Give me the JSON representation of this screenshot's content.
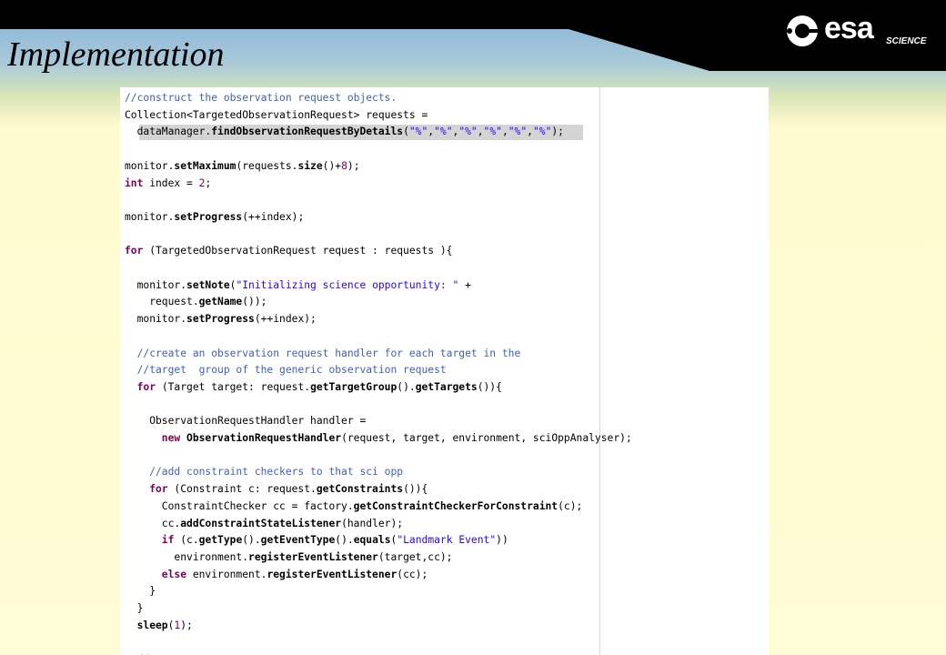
{
  "slide": {
    "title": "Implementation",
    "logo": {
      "word": "esa",
      "subtitle": "SCIENCE"
    }
  },
  "code": {
    "lines": [
      [
        [
          "comment",
          "//construct the observation request objects."
        ]
      ],
      [
        [
          "plain",
          "Collection<TargetedObservationRequest> requests ="
        ]
      ],
      [
        [
          "plain",
          "  dataManager."
        ],
        [
          "method",
          "findObservationRequestByDetails"
        ],
        [
          "plain",
          "("
        ],
        [
          "str",
          "\"%\""
        ],
        [
          "plain",
          ","
        ],
        [
          "str",
          "\"%\""
        ],
        [
          "plain",
          ","
        ],
        [
          "str",
          "\"%\""
        ],
        [
          "plain",
          ","
        ],
        [
          "str",
          "\"%\""
        ],
        [
          "plain",
          ","
        ],
        [
          "str",
          "\"%\""
        ],
        [
          "plain",
          ","
        ],
        [
          "str",
          "\"%\""
        ],
        [
          "plain",
          ");"
        ]
      ],
      [],
      [
        [
          "plain",
          "monitor."
        ],
        [
          "method",
          "setMaximum"
        ],
        [
          "plain",
          "(requests."
        ],
        [
          "method",
          "size"
        ],
        [
          "plain",
          "()+"
        ],
        [
          "num",
          "8"
        ],
        [
          "plain",
          ");"
        ]
      ],
      [
        [
          "kw",
          "int"
        ],
        [
          "plain",
          " index = "
        ],
        [
          "num",
          "2"
        ],
        [
          "plain",
          ";"
        ]
      ],
      [],
      [
        [
          "plain",
          "monitor."
        ],
        [
          "method",
          "setProgress"
        ],
        [
          "plain",
          "(++index);"
        ]
      ],
      [],
      [
        [
          "kw",
          "for"
        ],
        [
          "plain",
          " (TargetedObservationRequest request : requests ){"
        ]
      ],
      [],
      [
        [
          "plain",
          "  monitor."
        ],
        [
          "method",
          "setNote"
        ],
        [
          "plain",
          "("
        ],
        [
          "str",
          "\"Initializing science opportunity: \""
        ],
        [
          "plain",
          " +"
        ]
      ],
      [
        [
          "plain",
          "    request."
        ],
        [
          "method",
          "getName"
        ],
        [
          "plain",
          "());"
        ]
      ],
      [
        [
          "plain",
          "  monitor."
        ],
        [
          "method",
          "setProgress"
        ],
        [
          "plain",
          "(++index);"
        ]
      ],
      [],
      [
        [
          "comment",
          "  //create an observation request handler for each target in the"
        ]
      ],
      [
        [
          "comment",
          "  //target  group of the generic observation request"
        ]
      ],
      [
        [
          "kw",
          "  for"
        ],
        [
          "plain",
          " (Target target: request."
        ],
        [
          "method",
          "getTargetGroup"
        ],
        [
          "plain",
          "()."
        ],
        [
          "method",
          "getTargets"
        ],
        [
          "plain",
          "()){"
        ]
      ],
      [],
      [
        [
          "plain",
          "    ObservationRequestHandler handler ="
        ]
      ],
      [
        [
          "kw",
          "      new"
        ],
        [
          "plain",
          " "
        ],
        [
          "method",
          "ObservationRequestHandler"
        ],
        [
          "plain",
          "(request, target, environment, sciOppAnalyser);"
        ]
      ],
      [],
      [
        [
          "comment",
          "    //add constraint checkers to that sci opp"
        ]
      ],
      [
        [
          "kw",
          "    for"
        ],
        [
          "plain",
          " (Constraint c: request."
        ],
        [
          "method",
          "getConstraints"
        ],
        [
          "plain",
          "()){"
        ]
      ],
      [
        [
          "plain",
          "      ConstraintChecker cc = factory."
        ],
        [
          "method",
          "getConstraintCheckerForConstraint"
        ],
        [
          "plain",
          "(c);"
        ]
      ],
      [
        [
          "plain",
          "      cc."
        ],
        [
          "method",
          "addConstraintStateListener"
        ],
        [
          "plain",
          "(handler);"
        ]
      ],
      [
        [
          "kw",
          "      if"
        ],
        [
          "plain",
          " (c."
        ],
        [
          "method",
          "getType"
        ],
        [
          "plain",
          "()."
        ],
        [
          "method",
          "getEventType"
        ],
        [
          "plain",
          "()."
        ],
        [
          "method",
          "equals"
        ],
        [
          "plain",
          "("
        ],
        [
          "str",
          "\"Landmark Event\""
        ],
        [
          "plain",
          "))"
        ]
      ],
      [
        [
          "plain",
          "        environment."
        ],
        [
          "method",
          "registerEventListener"
        ],
        [
          "plain",
          "(target,cc);"
        ]
      ],
      [
        [
          "kw",
          "      else"
        ],
        [
          "plain",
          " environment."
        ],
        [
          "method",
          "registerEventListener"
        ],
        [
          "plain",
          "(cc);"
        ]
      ],
      [
        [
          "plain",
          "    }"
        ]
      ],
      [
        [
          "plain",
          "  }"
        ]
      ],
      [
        [
          "method",
          "  sleep"
        ],
        [
          "plain",
          "("
        ],
        [
          "num",
          "1"
        ],
        [
          "plain",
          ");"
        ]
      ],
      [],
      [
        [
          "comment",
          "  //  ..."
        ]
      ]
    ]
  },
  "colors": {
    "comment": "#3f5fbf",
    "keyword": "#7f0055",
    "string": "#2a00ff",
    "highlight": "#d4d4d4"
  }
}
